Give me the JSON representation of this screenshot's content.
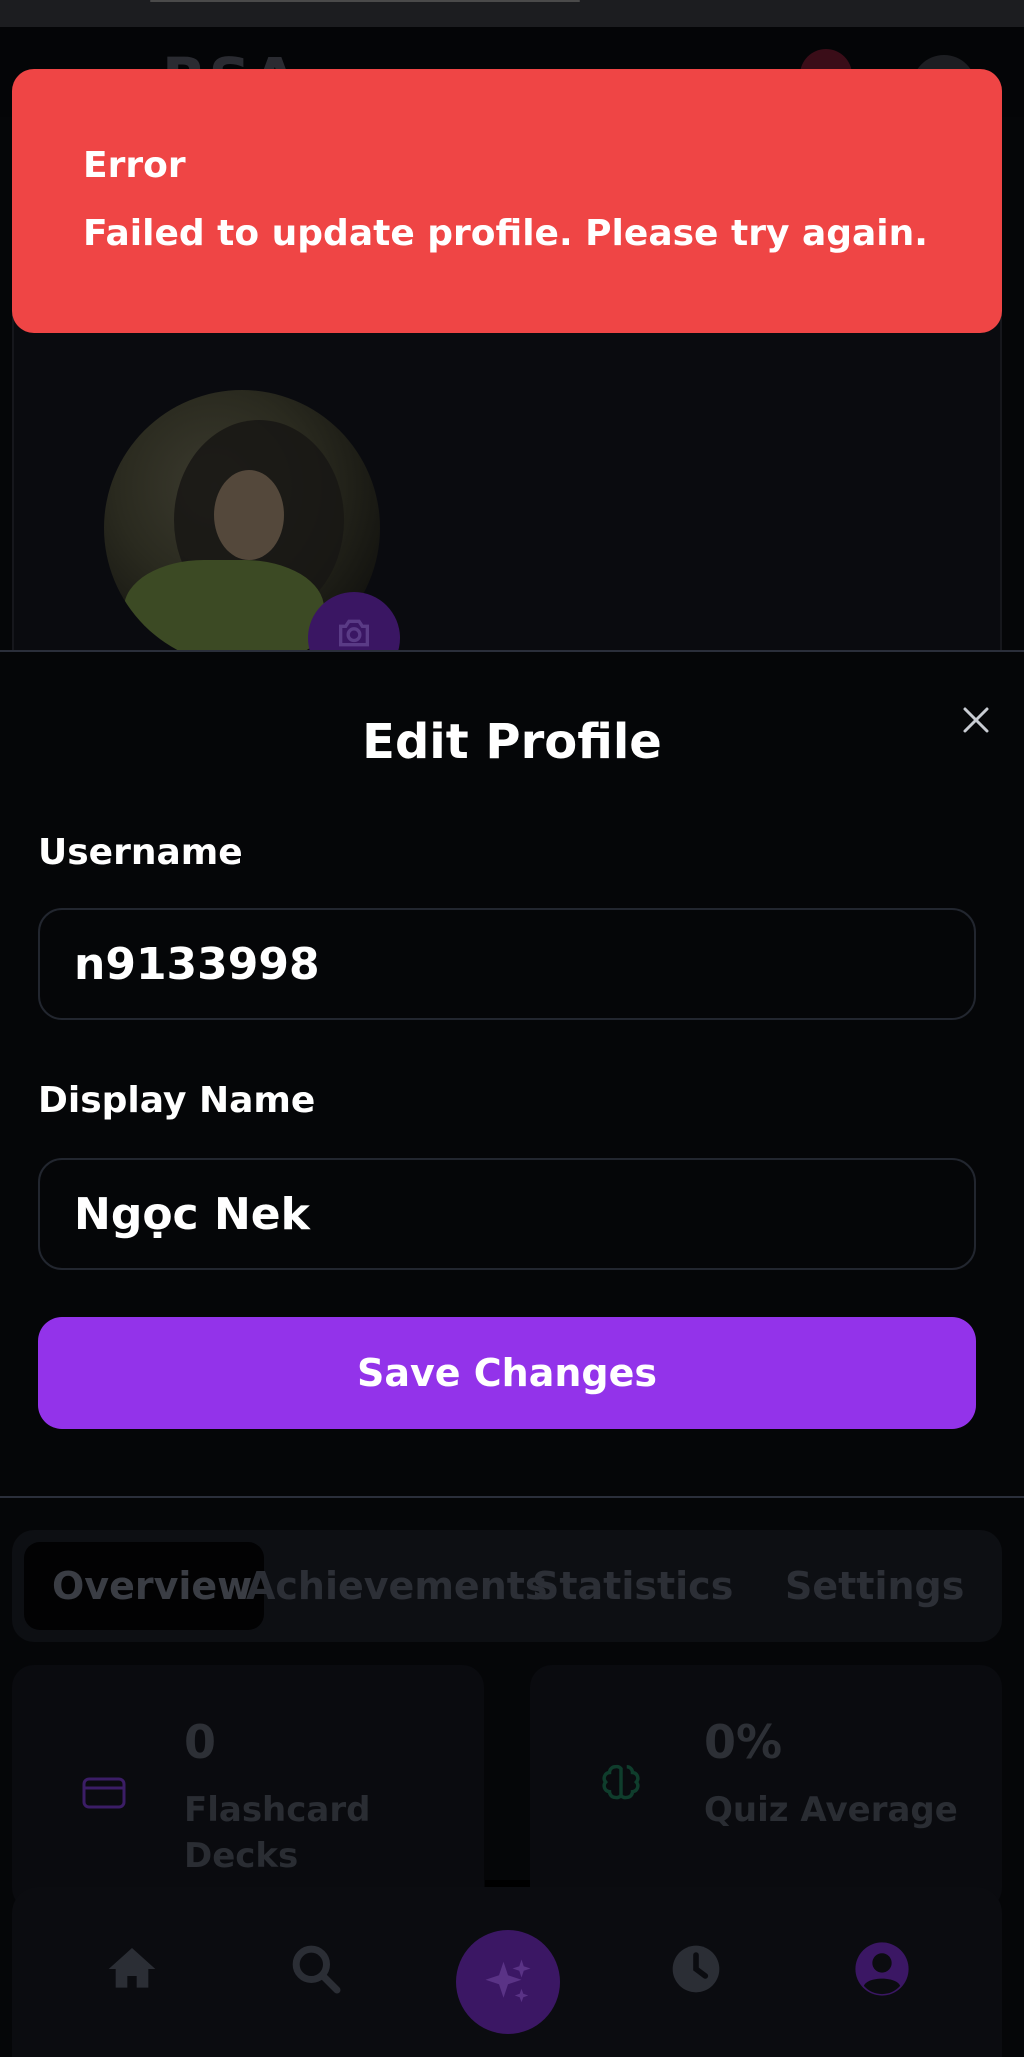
{
  "app": {
    "logo_text": "RSA"
  },
  "toast": {
    "title": "Error",
    "message": "Failed to update profile. Please try again."
  },
  "modal": {
    "title": "Edit Profile",
    "username_label": "Username",
    "username_value": "n9133998",
    "display_name_label": "Display Name",
    "display_name_value": "Ngọc Nek",
    "save_label": "Save Changes"
  },
  "tabs": [
    {
      "label": "Overview",
      "active": true
    },
    {
      "label": "Achievements",
      "active": false
    },
    {
      "label": "Statistics",
      "active": false
    },
    {
      "label": "Settings",
      "active": false
    }
  ],
  "stats": [
    {
      "value": "0",
      "label": "Flashcard Decks",
      "icon": "card-icon",
      "color": "#3b1d66"
    },
    {
      "value": "0%",
      "label": "Quiz Average",
      "icon": "brain-icon",
      "color": "#0f3d2c"
    }
  ],
  "bottom_nav": [
    {
      "icon": "home-icon"
    },
    {
      "icon": "search-icon"
    },
    {
      "icon": "sparkles-icon"
    },
    {
      "icon": "clock-icon"
    },
    {
      "icon": "user-icon"
    }
  ],
  "colors": {
    "toast_bg": "#ef4545",
    "accent": "#9333ea",
    "background": "#050608"
  }
}
